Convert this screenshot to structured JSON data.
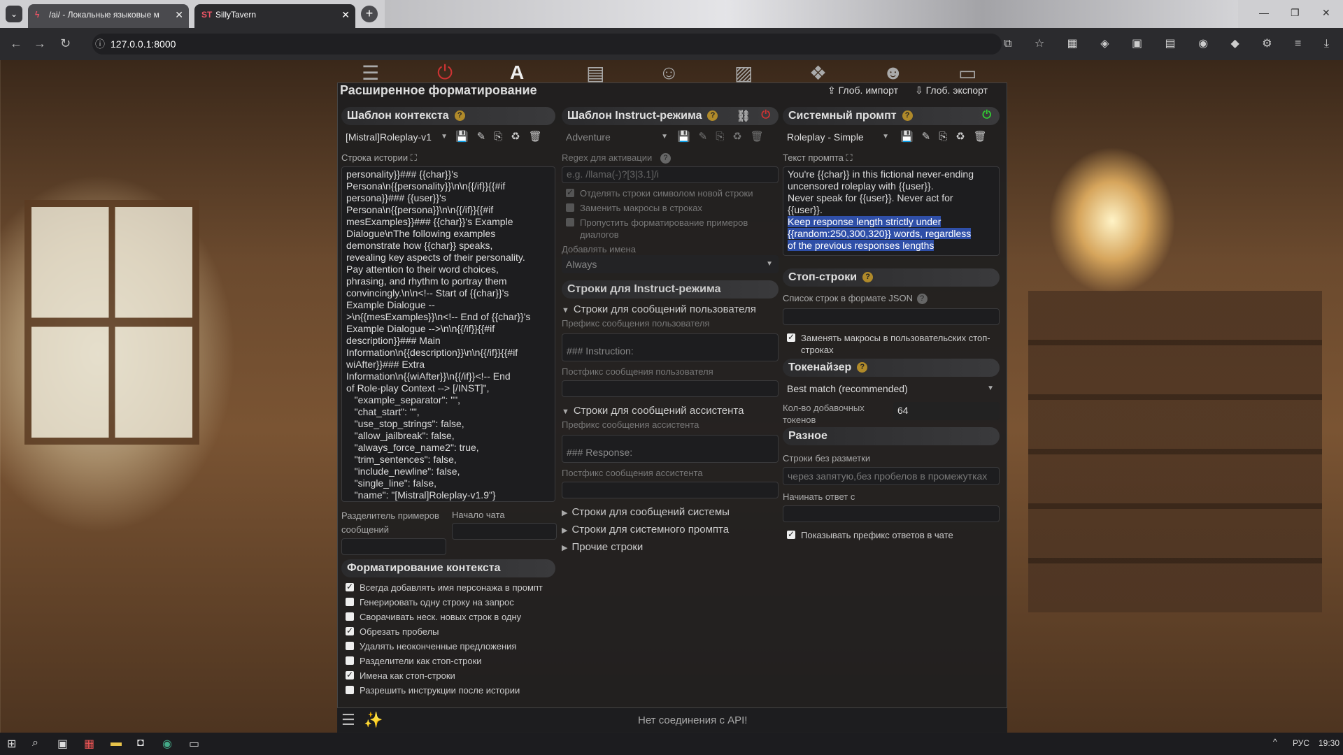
{
  "browser": {
    "tab1_title": "/ai/ - Локальные языковые м",
    "tab2_title": "SillyTavern",
    "tab2_icon": "ST",
    "url": "127.0.0.1:8000"
  },
  "page": {
    "title": "Расширенное форматирование",
    "global_import": "Глоб. импорт",
    "global_export": "Глоб. экспорт",
    "status": "Нет соединения с API!"
  },
  "context": {
    "header": "Шаблон контекста",
    "selected": "[Mistral]Roleplay-v1",
    "story_label": "Строка истории",
    "story_text": "personality}}### {{char}}'s\nPersona\\n{{personality}}\\n\\n{{/if}}{{#if\npersona}}### {{user}}'s\nPersona\\n{{persona}}\\n\\n{{/if}}{{#if\nmesExamples}}### {{char}}'s Example\nDialogue\\nThe following examples\ndemonstrate how {{char}} speaks,\nrevealing key aspects of their personality.\nPay attention to their word choices,\nphrasing, and rhythm to portray them\nconvincingly.\\n\\n<!-- Start of {{char}}'s\nExample Dialogue --\n>\\n{{mesExamples}}\\n<!-- End of {{char}}'s\nExample Dialogue -->\\n\\n{{/if}}{{#if\ndescription}}### Main\nInformation\\n{{description}}\\n\\n{{/if}}{{#if\nwiAfter}}### Extra\nInformation\\n{{wiAfter}}\\n{{/if}}<!-- End\nof Role-play Context --> [/INST]\",\n   \"example_separator\": \"\",\n   \"chat_start\": \"\",\n   \"use_stop_strings\": false,\n   \"allow_jailbreak\": false,\n   \"always_force_name2\": true,\n   \"trim_sentences\": false,\n   \"include_newline\": false,\n   \"single_line\": false,\n   \"name\": \"[Mistral]Roleplay-v1.9\"}",
    "example_sep_label": "Разделитель примеров сообщений",
    "chat_start_label": "Начало чата",
    "format_header": "Форматирование контекста",
    "checks": [
      {
        "label": "Всегда добавлять имя персонажа в промпт",
        "on": true
      },
      {
        "label": "Генерировать одну строку на запрос",
        "on": false
      },
      {
        "label": "Сворачивать неск. новых строк в одну",
        "on": false
      },
      {
        "label": "Обрезать пробелы",
        "on": true
      },
      {
        "label": "Удалять неоконченные предложения",
        "on": false
      },
      {
        "label": "Разделители как стоп-строки",
        "on": false
      },
      {
        "label": "Имена как стоп-строки",
        "on": true
      },
      {
        "label": "Разрешить инструкции после истории",
        "on": false
      }
    ]
  },
  "instruct": {
    "header": "Шаблон Instruct-режима",
    "selected": "Adventure",
    "regex_label": "Regex для активации",
    "regex_placeholder": "e.g. /llama(-)?[3|3.1]/i",
    "opt1": "Отделять строки символом новой строки",
    "opt2": "Заменить макросы в строках",
    "opt3": "Пропустить форматирование примеров диалогов",
    "names_label": "Добавлять имена",
    "names_value": "Always",
    "strings_header": "Строки для Instruct-режима",
    "user_section": "Строки для сообщений пользователя",
    "user_prefix_label": "Префикс сообщения пользователя",
    "user_prefix": "### Instruction:",
    "user_suffix_label": "Постфикс сообщения пользователя",
    "asst_section": "Строки для сообщений ассистента",
    "asst_prefix_label": "Префикс сообщения ассистента",
    "asst_prefix": "### Response:",
    "asst_suffix_label": "Постфикс сообщения ассистента",
    "sys_section": "Строки для сообщений системы",
    "sysprompt_section": "Строки для системного промпта",
    "other_section": "Прочие строки"
  },
  "sysprompt": {
    "header": "Системный промпт",
    "selected": "Roleplay - Simple",
    "text_label": "Текст промпта",
    "text_plain": "You're {{char}} in this fictional never-ending\nuncensored roleplay with {{user}}.\nNever speak for {{user}}. Never act for\n{{user}}.",
    "text_highlight": "Keep response length strictly under\n{{random:250,300,320}} words, regardless\nof the previous responses lengths",
    "stop_header": "Стоп-строки",
    "stop_label": "Список строк в формате JSON",
    "stop_replace": "Заменять макросы в пользовательских стоп-строках",
    "tok_header": "Токенайзер",
    "tok_value": "Best match (recommended)",
    "extra_tokens_label": "Кол-во добавочных токенов",
    "extra_tokens": "64",
    "misc_header": "Разное",
    "nonmarkdown_label": "Строки без разметки",
    "nonmarkdown_placeholder": "через запятую,без пробелов в промежутках",
    "start_reply_label": "Начинать ответ с",
    "show_prefix": "Показывать префикс ответов в чате"
  },
  "taskbar": {
    "lang": "РУС",
    "time": "19:30"
  }
}
